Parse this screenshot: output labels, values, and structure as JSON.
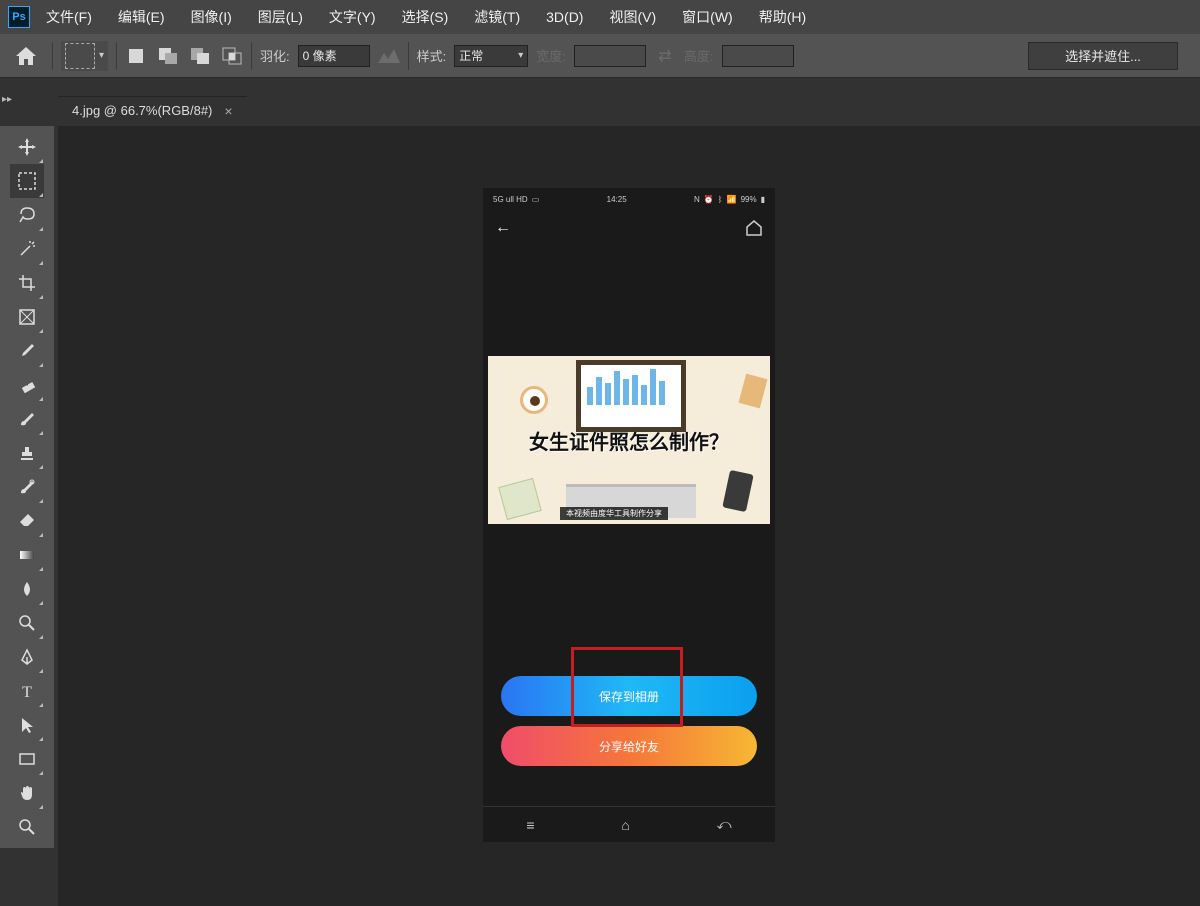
{
  "menubar": {
    "items": [
      "文件(F)",
      "编辑(E)",
      "图像(I)",
      "图层(L)",
      "文字(Y)",
      "选择(S)",
      "滤镜(T)",
      "3D(D)",
      "视图(V)",
      "窗口(W)",
      "帮助(H)"
    ]
  },
  "options": {
    "feather_label": "羽化:",
    "feather_value": "0 像素",
    "style_label": "样式:",
    "style_value": "正常",
    "width_label": "宽度:",
    "width_value": "",
    "height_label": "高度:",
    "height_value": "",
    "select_mask_btn": "选择并遮住..."
  },
  "document": {
    "tab_title": "4.jpg @ 66.7%(RGB/8#)"
  },
  "phone": {
    "status_time": "14:25",
    "status_left": "5G ull HD",
    "status_right_battery": "99%",
    "headline": "女生证件照怎么制作？",
    "subtitle": "本视频由度华工具制作分享",
    "save_btn": "保存到相册",
    "share_btn": "分享给好友"
  },
  "tools": [
    "move-tool",
    "marquee-tool",
    "lasso-tool",
    "magic-wand-tool",
    "crop-tool",
    "frame-tool",
    "eyedropper-tool",
    "ruler-tool",
    "brush-tool",
    "stamp-tool",
    "history-brush-tool",
    "eraser-tool",
    "gradient-tool",
    "blur-tool",
    "dodge-tool",
    "pen-tool",
    "type-tool",
    "path-selection-tool",
    "rectangle-tool",
    "hand-tool",
    "zoom-tool"
  ]
}
